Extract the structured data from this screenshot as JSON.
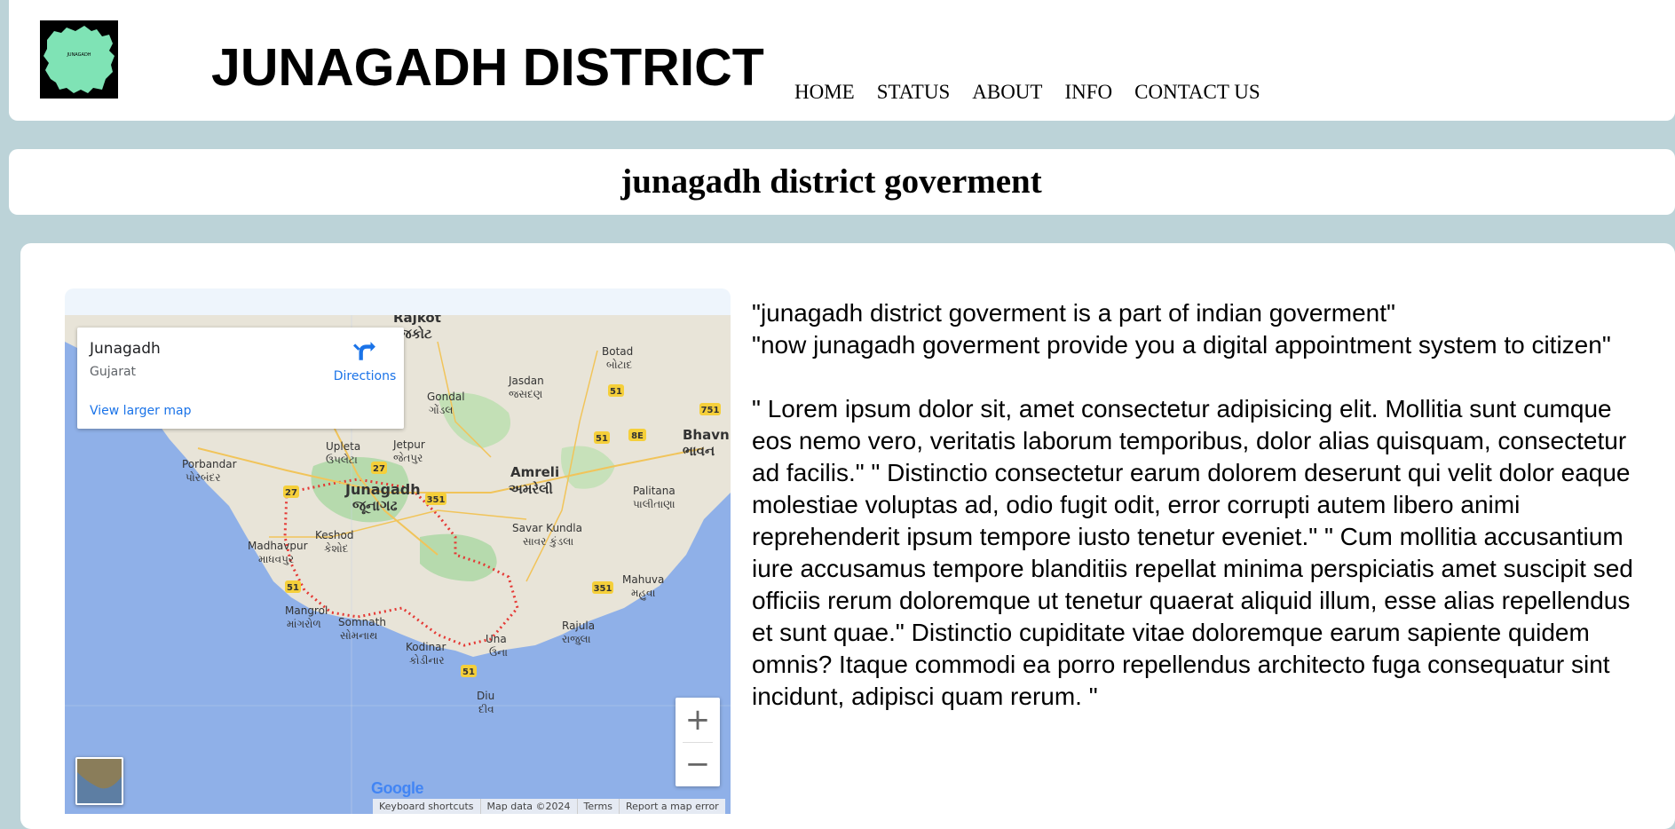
{
  "header": {
    "logo_text": "JUNAGADH",
    "title": "JUNAGADH DISTRICT",
    "nav": [
      "HOME",
      "STATUS",
      "ABOUT",
      "INFO",
      "CONTACT US"
    ]
  },
  "banner": {
    "heading": "junagadh district goverment"
  },
  "map": {
    "card": {
      "place": "Junagadh",
      "region": "Gujarat",
      "directions": "Directions",
      "view_larger": "View larger map"
    },
    "zoom_in": "+",
    "zoom_out": "−",
    "google_logo": "Google",
    "attribution": [
      "Keyboard shortcuts",
      "Map data ©2024",
      "Terms",
      "Report a map error"
    ],
    "places": [
      {
        "name": "Rajkot",
        "local": "રાજકોટ"
      },
      {
        "name": "Botad",
        "local": "બોટાદ"
      },
      {
        "name": "Jasdan",
        "local": "જસદણ"
      },
      {
        "name": "Gondal",
        "local": "ગોંડલ"
      },
      {
        "name": "Bhavn",
        "local": "ભાવન"
      },
      {
        "name": "Upleta",
        "local": "ઉપલેટા"
      },
      {
        "name": "Jetpur",
        "local": "જેતપુર"
      },
      {
        "name": "Porbandar",
        "local": "પોરબંદર"
      },
      {
        "name": "Amreli",
        "local": "અમરેલી"
      },
      {
        "name": "Junagadh",
        "local": "જૂનાગઢ"
      },
      {
        "name": "Palitana",
        "local": "પાલીતાણા"
      },
      {
        "name": "Keshod",
        "local": "કેશોદ"
      },
      {
        "name": "Savar Kundla",
        "local": "સાવર કુંડલા"
      },
      {
        "name": "Madhavpur",
        "local": "માધવપુર"
      },
      {
        "name": "Mahuva",
        "local": "મહુવા"
      },
      {
        "name": "Mangrol",
        "local": "માંગરોળ"
      },
      {
        "name": "Somnath",
        "local": "સોમનાથ"
      },
      {
        "name": "Rajula",
        "local": "રાજુલા"
      },
      {
        "name": "Kodinar",
        "local": "કોડીનાર"
      },
      {
        "name": "Una",
        "local": "ઉના"
      },
      {
        "name": "Diu",
        "local": "દીવ"
      }
    ],
    "road_shields": [
      "27",
      "27",
      "351",
      "51",
      "51",
      "8E",
      "751",
      "51",
      "351",
      "51"
    ]
  },
  "content": {
    "intro_lines": [
      "\"junagadh district goverment is a part of indian goverment\"",
      "\"now junagadh goverment provide you a digital appointment system to citizen\""
    ],
    "body": "\" Lorem ipsum dolor sit, amet consectetur adipisicing elit. Mollitia sunt cumque eos nemo vero, veritatis laborum temporibus, dolor alias quisquam, consectetur ad facilis.\" \" Distinctio consectetur earum dolorem deserunt qui velit dolor eaque molestiae voluptas ad, odio fugit odit, error corrupti autem libero animi reprehenderit ipsum tempore iusto tenetur eveniet.\" \" Cum mollitia accusantium iure accusamus tempore blanditiis repellat minima perspiciatis amet suscipit sed officiis rerum doloremque ut tenetur quaerat aliquid illum, esse alias repellendus et sunt quae.\" Distinctio cupiditate vitae doloremque earum sapiente quidem omnis? Itaque commodi ea porro repellendus architecto fuga consequatur sint incidunt, adipisci quam rerum. \""
  },
  "colors": {
    "page_bg": "#bcd3d8",
    "logo_map": "#7fe3b5",
    "sea": "#8fb0e8",
    "land": "#e8e4d8",
    "green_area": "#a9d7a2",
    "link_blue": "#1a73e8",
    "boundary_red": "#e53935"
  },
  "icons": [
    "directions-icon",
    "logo-map-icon",
    "layer-thumbnail"
  ]
}
